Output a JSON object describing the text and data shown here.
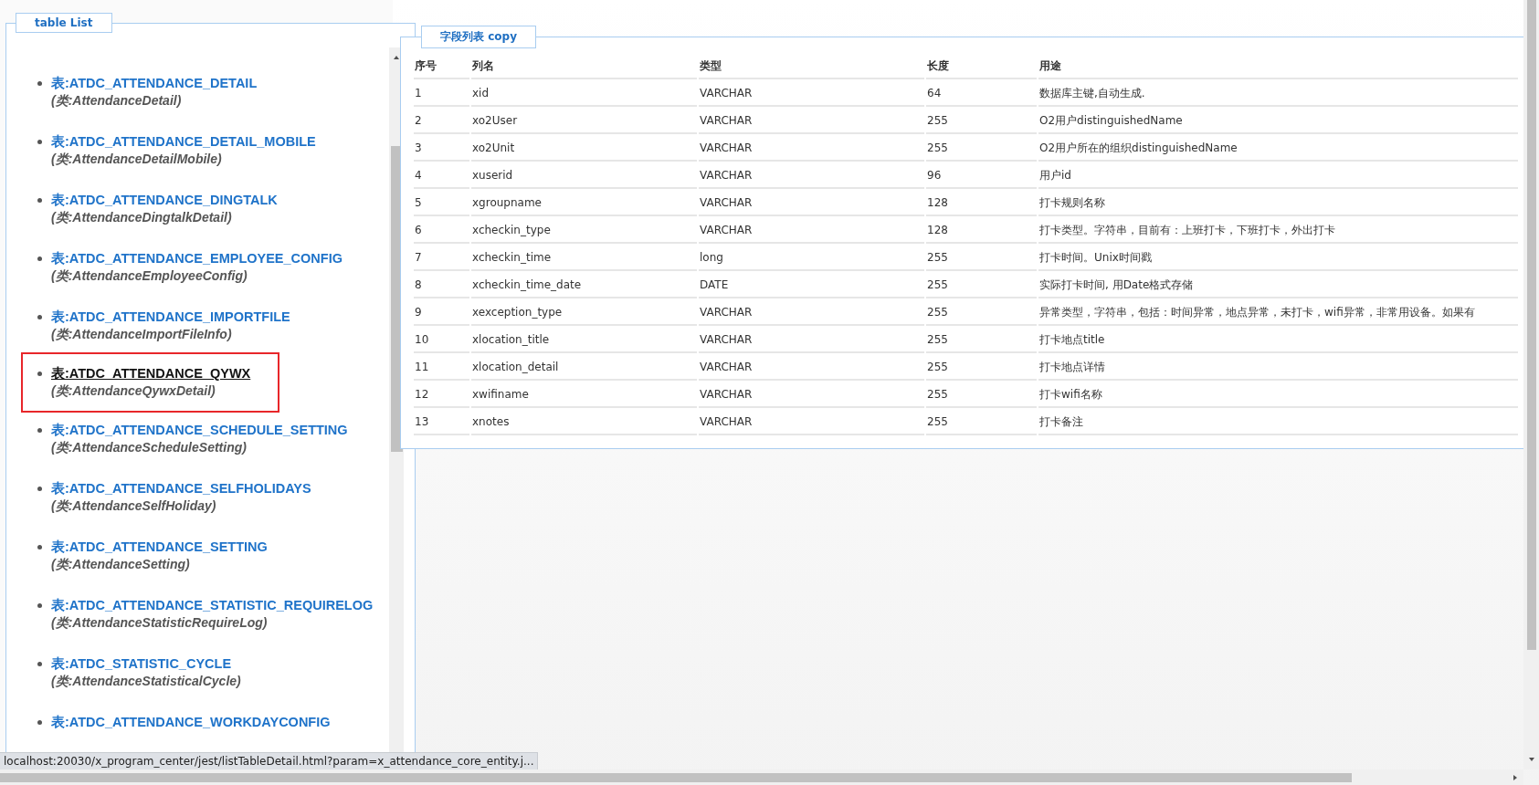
{
  "table_list": {
    "legend": "table List",
    "items": [
      {
        "title": "表:ATDC_ATTENDANCE_DETAIL",
        "class": "(类:AttendanceDetail)",
        "selected": false
      },
      {
        "title": "表:ATDC_ATTENDANCE_DETAIL_MOBILE",
        "class": "(类:AttendanceDetailMobile)",
        "selected": false
      },
      {
        "title": "表:ATDC_ATTENDANCE_DINGTALK",
        "class": "(类:AttendanceDingtalkDetail)",
        "selected": false
      },
      {
        "title": "表:ATDC_ATTENDANCE_EMPLOYEE_CONFIG",
        "class": "(类:AttendanceEmployeeConfig)",
        "selected": false
      },
      {
        "title": "表:ATDC_ATTENDANCE_IMPORTFILE",
        "class": "(类:AttendanceImportFileInfo)",
        "selected": false
      },
      {
        "title": "表:ATDC_ATTENDANCE_QYWX",
        "class": "(类:AttendanceQywxDetail)",
        "selected": true
      },
      {
        "title": "表:ATDC_ATTENDANCE_SCHEDULE_SETTING",
        "class": "(类:AttendanceScheduleSetting)",
        "selected": false
      },
      {
        "title": "表:ATDC_ATTENDANCE_SELFHOLIDAYS",
        "class": "(类:AttendanceSelfHoliday)",
        "selected": false
      },
      {
        "title": "表:ATDC_ATTENDANCE_SETTING",
        "class": "(类:AttendanceSetting)",
        "selected": false
      },
      {
        "title": "表:ATDC_ATTENDANCE_STATISTIC_REQUIRELOG",
        "class": "(类:AttendanceStatisticRequireLog)",
        "selected": false
      },
      {
        "title": "表:ATDC_STATISTIC_CYCLE",
        "class": "(类:AttendanceStatisticalCycle)",
        "selected": false
      },
      {
        "title": "表:ATDC_ATTENDANCE_WORKDAYCONFIG",
        "selected": false
      }
    ]
  },
  "field_table": {
    "legend": "字段列表 copy",
    "columns": [
      "序号",
      "列名",
      "类型",
      "长度",
      "用途"
    ],
    "rows": [
      [
        "1",
        "xid",
        "VARCHAR",
        "64",
        "数据库主键,自动生成."
      ],
      [
        "2",
        "xo2User",
        "VARCHAR",
        "255",
        "O2用户distinguishedName"
      ],
      [
        "3",
        "xo2Unit",
        "VARCHAR",
        "255",
        "O2用户所在的组织distinguishedName"
      ],
      [
        "4",
        "xuserid",
        "VARCHAR",
        "96",
        "用户id"
      ],
      [
        "5",
        "xgroupname",
        "VARCHAR",
        "128",
        "打卡规则名称"
      ],
      [
        "6",
        "xcheckin_type",
        "VARCHAR",
        "128",
        "打卡类型。字符串，目前有：上班打卡，下班打卡，外出打卡"
      ],
      [
        "7",
        "xcheckin_time",
        "long",
        "255",
        "打卡时间。Unix时间戳"
      ],
      [
        "8",
        "xcheckin_time_date",
        "DATE",
        "255",
        "实际打卡时间, 用Date格式存储"
      ],
      [
        "9",
        "xexception_type",
        "VARCHAR",
        "255",
        "异常类型，字符串，包括：时间异常，地点异常，未打卡，wifi异常，非常用设备。如果有"
      ],
      [
        "10",
        "xlocation_title",
        "VARCHAR",
        "255",
        "打卡地点title"
      ],
      [
        "11",
        "xlocation_detail",
        "VARCHAR",
        "255",
        "打卡地点详情"
      ],
      [
        "12",
        "xwifiname",
        "VARCHAR",
        "255",
        "打卡wifi名称"
      ],
      [
        "13",
        "xnotes",
        "VARCHAR",
        "255",
        "打卡备注"
      ]
    ]
  },
  "status_url": "localhost:20030/x_program_center/jest/listTableDetail.html?param=x_attendance_core_entity.j..."
}
